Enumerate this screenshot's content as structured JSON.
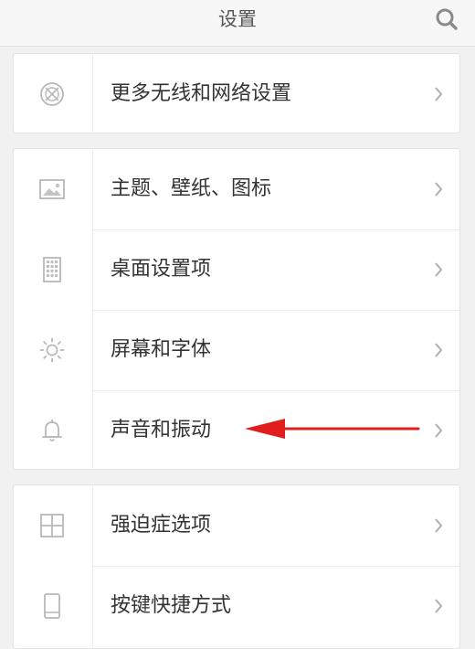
{
  "header": {
    "title": "设置",
    "search_icon": "search-icon"
  },
  "cards": [
    {
      "items": [
        {
          "label": "更多无线和网络设置",
          "icon": "network-icon"
        }
      ]
    },
    {
      "items": [
        {
          "label": "主题、壁纸、图标",
          "icon": "image-icon"
        },
        {
          "label": "桌面设置项",
          "icon": "grid-dots-icon"
        },
        {
          "label": "屏幕和字体",
          "icon": "brightness-icon"
        },
        {
          "label": "声音和振动",
          "icon": "bell-icon"
        }
      ]
    },
    {
      "items": [
        {
          "label": "强迫症选项",
          "icon": "four-squares-icon"
        },
        {
          "label": "按键快捷方式",
          "icon": "phone-icon"
        }
      ]
    }
  ],
  "annotation": {
    "color": "#e01e1e",
    "target": "声音和振动"
  },
  "colors": {
    "icon": "#b8b8b8",
    "chevron": "#b0b0b0",
    "text": "#333333",
    "title": "#555555"
  }
}
